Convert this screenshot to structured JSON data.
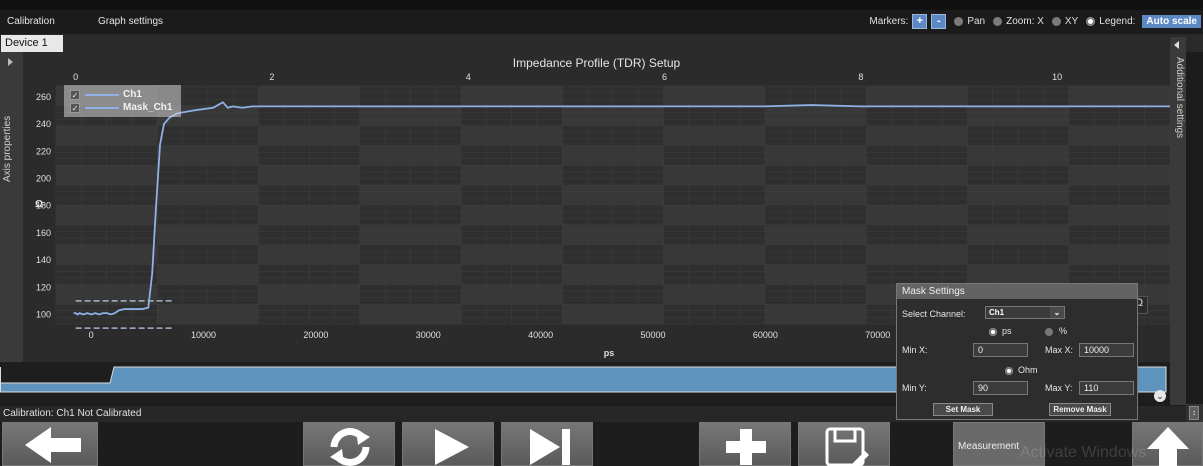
{
  "menu": {
    "calibration": "Calibration",
    "graph_settings": "Graph settings"
  },
  "toolbar": {
    "markers_label": "Markers:",
    "add_marker": "+",
    "remove_marker": "-",
    "pan_label": "Pan",
    "zoom_label": "Zoom: X",
    "xy_label": "XY",
    "legend_label": "Legend:",
    "autoscale_label": "Auto scale",
    "selected_mode": "Legend"
  },
  "tab": {
    "device": "Device 1"
  },
  "side": {
    "left_label": "Axis properties",
    "right_label": "Additional settings"
  },
  "chart": {
    "title": "Impedance Profile (TDR) Setup",
    "unit_symbol": "Ω",
    "legend": [
      {
        "label": "Ch1",
        "checked": true
      },
      {
        "label": "Mask_Ch1",
        "checked": true
      }
    ]
  },
  "chart_data": {
    "type": "line",
    "title": "Impedance Profile (TDR) Setup",
    "xlabel": "ps",
    "ylabel": "Ω",
    "xlim": [
      -200,
      11150
    ],
    "ylim": [
      93,
      268
    ],
    "x_ticks": [
      0,
      10000,
      20000,
      30000,
      40000,
      50000,
      60000,
      70000
    ],
    "x_ticks_top": [
      0,
      2,
      4,
      6,
      8,
      10
    ],
    "y_ticks": [
      100,
      120,
      140,
      160,
      180,
      200,
      220,
      240,
      260
    ],
    "grid": true,
    "legend": "top-left",
    "series": [
      {
        "name": "Ch1",
        "color": "#8fb1e6",
        "points": [
          [
            -200,
            101
          ],
          [
            0,
            101
          ],
          [
            200,
            100
          ],
          [
            400,
            101
          ],
          [
            800,
            100
          ],
          [
            1200,
            101
          ],
          [
            1600,
            100
          ],
          [
            2000,
            101
          ],
          [
            2400,
            100
          ],
          [
            2800,
            101
          ],
          [
            3200,
            101
          ],
          [
            3600,
            100
          ],
          [
            4000,
            101
          ],
          [
            4400,
            103
          ],
          [
            5000,
            104
          ],
          [
            5600,
            104
          ],
          [
            6200,
            104
          ],
          [
            6800,
            104
          ],
          [
            7400,
            105
          ],
          [
            7800,
            130
          ],
          [
            8200,
            180
          ],
          [
            8600,
            225
          ],
          [
            9000,
            240
          ],
          [
            9600,
            245
          ],
          [
            10400,
            248
          ],
          [
            11200,
            249
          ],
          [
            12000,
            250
          ],
          [
            13000,
            251
          ],
          [
            14000,
            252
          ],
          [
            15000,
            256
          ],
          [
            15500,
            252
          ],
          [
            16000,
            253
          ],
          [
            17000,
            252
          ],
          [
            18000,
            253
          ],
          [
            19000,
            253
          ],
          [
            20000,
            253
          ],
          [
            22000,
            253
          ],
          [
            24000,
            253
          ],
          [
            26000,
            253
          ],
          [
            28000,
            253
          ],
          [
            30000,
            253
          ],
          [
            35000,
            253
          ],
          [
            40000,
            253
          ],
          [
            45000,
            253
          ],
          [
            50000,
            253
          ],
          [
            55000,
            253
          ],
          [
            60000,
            253
          ],
          [
            65000,
            253
          ],
          [
            70000,
            253
          ],
          [
            75000,
            254
          ],
          [
            80000,
            253
          ],
          [
            85000,
            253
          ],
          [
            90000,
            253
          ],
          [
            95000,
            253
          ],
          [
            100000,
            253
          ],
          [
            105000,
            253
          ],
          [
            110000,
            253
          ],
          [
            111500,
            253
          ]
        ]
      },
      {
        "name": "Mask_Ch1",
        "color": "#8fb1e6",
        "dashed": true,
        "segments": [
          [
            [
              0,
              110
            ],
            [
              10000,
              110
            ]
          ],
          [
            [
              0,
              90
            ],
            [
              10000,
              90
            ]
          ]
        ]
      }
    ]
  },
  "mask_settings": {
    "title": "Mask Settings",
    "select_channel_label": "Select Channel:",
    "channel": "Ch1",
    "unit_x_ps": "ps",
    "unit_x_pct": "%",
    "unit_y": "Ohm",
    "x_unit_selected": "ps",
    "min_x_label": "Min X:",
    "min_x": "0",
    "max_x_label": "Max X:",
    "max_x": "10000",
    "min_y_label": "Min Y:",
    "min_y": "90",
    "max_y_label": "Max Y:",
    "max_y": "110",
    "set_mask": "Set Mask",
    "remove_mask": "Remove Mask"
  },
  "status": {
    "text": "Calibration: Ch1 Not Calibrated"
  },
  "bottom": {
    "measurement_label": "Measurement",
    "watermark": "Activate Windows"
  }
}
